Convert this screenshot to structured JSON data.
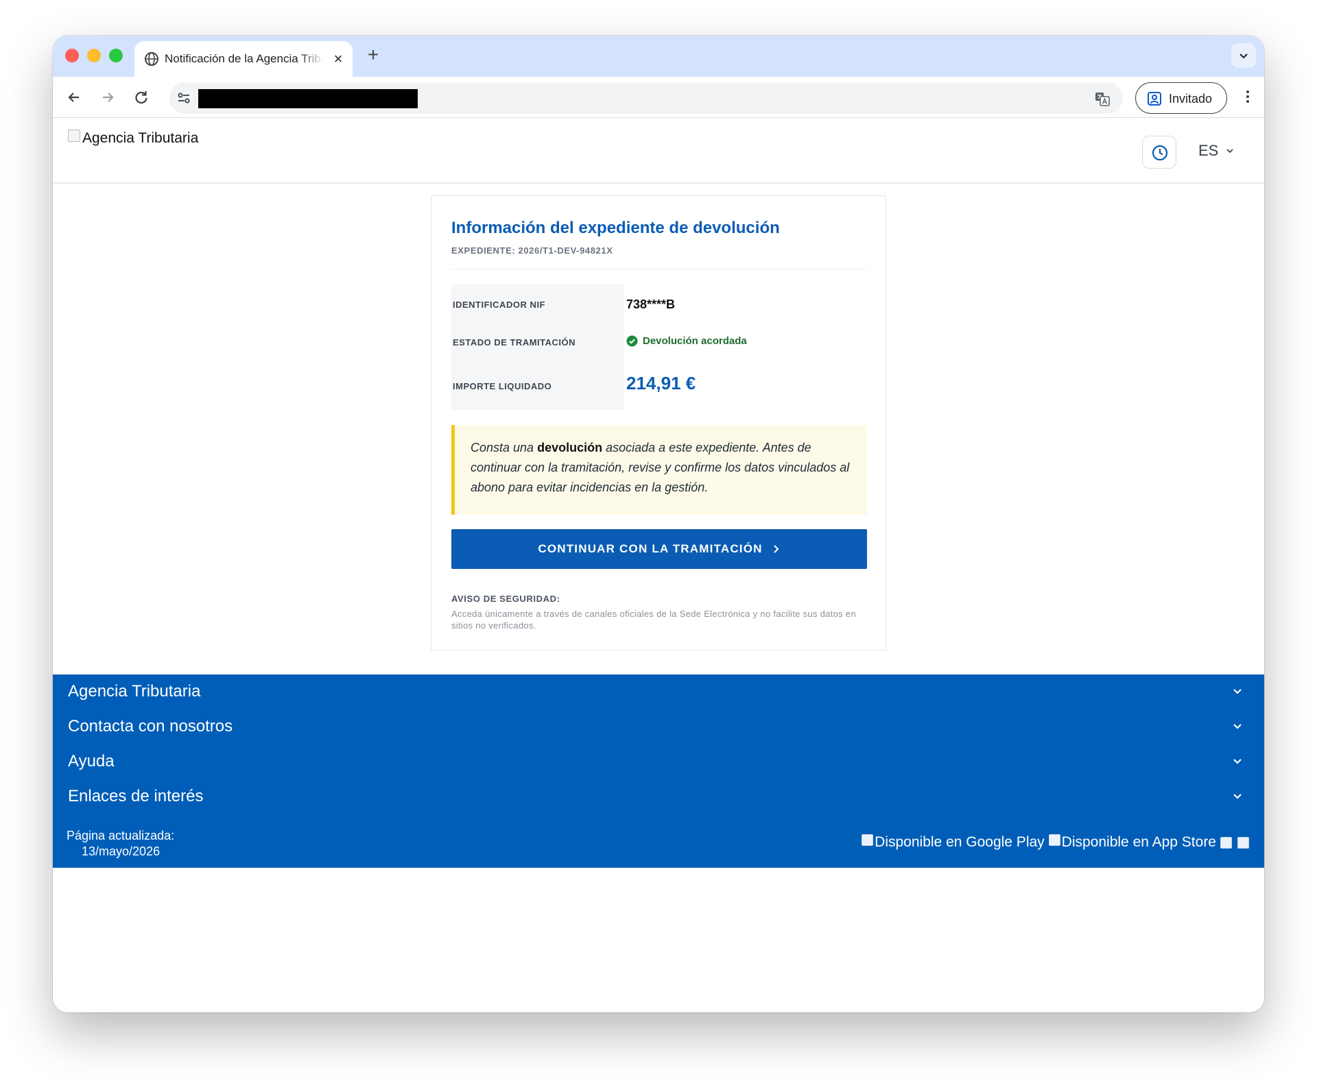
{
  "browser": {
    "tab_title": "Notificación de la Agencia Tributaria",
    "tab_close": "×",
    "new_tab": "+",
    "url_redacted": "",
    "profile_label": "Invitado"
  },
  "header": {
    "logo_alt": "Agencia Tributaria",
    "language": "ES"
  },
  "card": {
    "title": "Información del expediente de devolución",
    "subtitle": "EXPEDIENTE: 2026/T1-DEV-94821X",
    "rows": [
      {
        "label": "IDENTIFICADOR NIF",
        "value": "738****B"
      },
      {
        "label": "ESTADO DE TRAMITACIÓN",
        "value": "Devolución acordada"
      },
      {
        "label": "IMPORTE LIQUIDADO",
        "value": "214,91 €"
      }
    ],
    "notice": {
      "before": "Consta una ",
      "bold": "devolución",
      "after": " asociada a este expediente. Antes de continuar con la tramitación, revise y confirme los datos vinculados al abono para evitar incidencias en la gestión."
    },
    "cta_label": "CONTINUAR CON LA TRAMITACIÓN",
    "security_title": "AVISO DE SEGURIDAD:",
    "security_text": "Acceda únicamente a través de canales oficiales de la Sede Electrónica y no facilite sus datos en sitios no verificados."
  },
  "footer": {
    "sections": [
      "Agencia Tributaria",
      "Contacta con nosotros",
      "Ayuda",
      "Enlaces de interés"
    ],
    "updated_label": "Página actualizada:",
    "updated_date": "13/mayo/2026",
    "badges": [
      "Disponible en Google Play",
      "Disponible en App Store"
    ]
  },
  "colors": {
    "brand_blue": "#0b5cb4",
    "footer_blue": "#005eb8",
    "status_green": "#1e6b2e",
    "notice_yellow": "#f5c518"
  }
}
